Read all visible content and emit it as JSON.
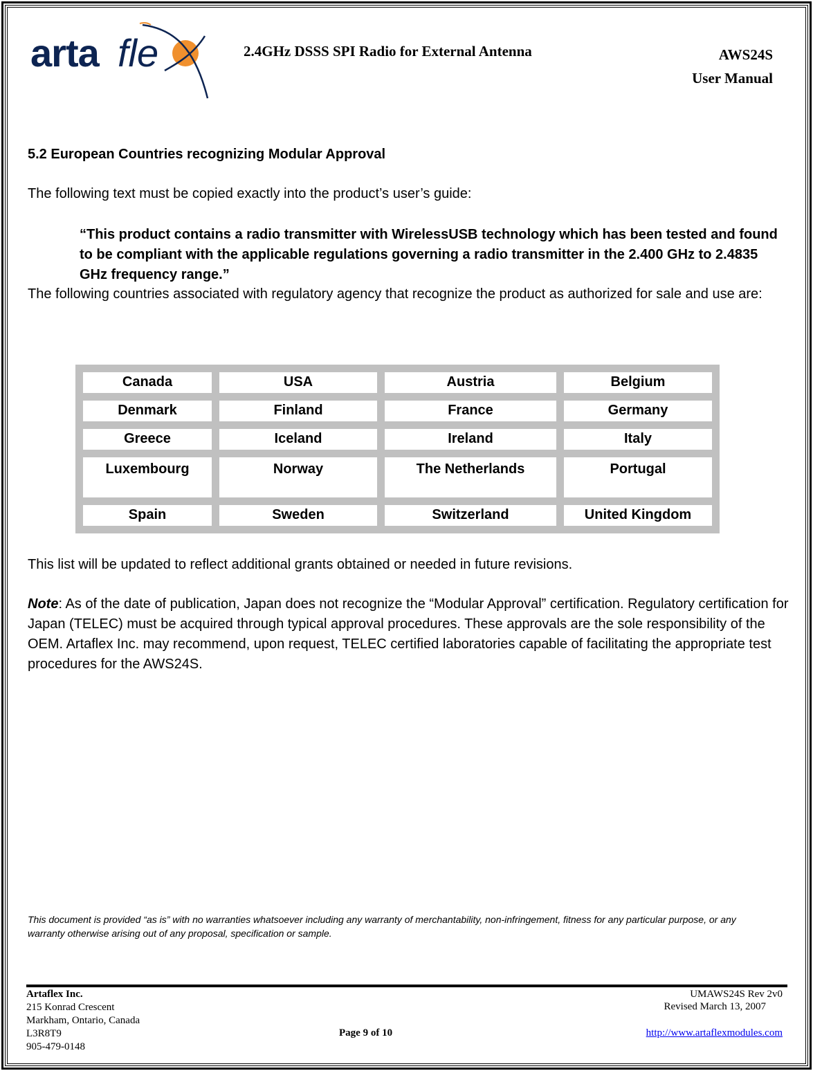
{
  "header": {
    "logo_text": "artaflex",
    "title": "2.4GHz DSSS SPI Radio for External Antenna",
    "product": "AWS24S",
    "doc_type": "User Manual"
  },
  "colors": {
    "logo_navy": "#0d2452",
    "logo_orange": "#f0902e",
    "table_border": "#c0c0c0",
    "link": "#0000ee"
  },
  "section": {
    "title": "5.2 European Countries recognizing Modular Approval",
    "intro": "The following text must be copied exactly into the product’s user’s guide:",
    "quote": "“This product contains a radio transmitter with WirelessUSB technology which has been tested and found to be compliant with the applicable regulations governing a radio transmitter in the 2.400 GHz to 2.4835 GHz frequency range.”",
    "countries_intro": "The following countries associated with regulatory agency that recognize the product as authorized for sale and use are:",
    "countries": [
      [
        "Canada",
        "USA",
        "Austria",
        "Belgium"
      ],
      [
        "Denmark",
        "Finland",
        "France",
        "Germany"
      ],
      [
        "Greece",
        "Iceland",
        "Ireland",
        "Italy"
      ],
      [
        "Luxembourg",
        "Norway",
        "The Netherlands",
        "Portugal"
      ],
      [
        "Spain",
        "Sweden",
        "Switzerland",
        "United Kingdom"
      ]
    ],
    "update_note": "This list will be updated to reflect additional grants obtained or needed in future revisions.",
    "note_label": "Note",
    "note_text": ": As of the date of publication, Japan does not recognize the “Modular Approval” certification. Regulatory certification for Japan (TELEC) must be acquired through typical approval procedures. These approvals are the sole responsibility of the OEM. Artaflex Inc. may recommend, upon request, TELEC certified laboratories capable of facilitating the appropriate test procedures for the AWS24S."
  },
  "disclaimer": "This document is provided “as is” with no warranties whatsoever including any warranty of merchantability, non-infringement, fitness for any particular purpose, or any warranty otherwise arising out of any proposal, specification or sample.",
  "footer": {
    "company": "Artaflex Inc.",
    "address1": "215 Konrad Crescent",
    "address2": "Markham, Ontario, Canada",
    "postal": "L3R8T9",
    "phone": "905-479-0148",
    "page": "Page 9 of 10",
    "revision": "UMAWS24S Rev 2v0",
    "revised_date": "Revised March 13, 2007",
    "url": "http://www.artaflexmodules.com"
  }
}
